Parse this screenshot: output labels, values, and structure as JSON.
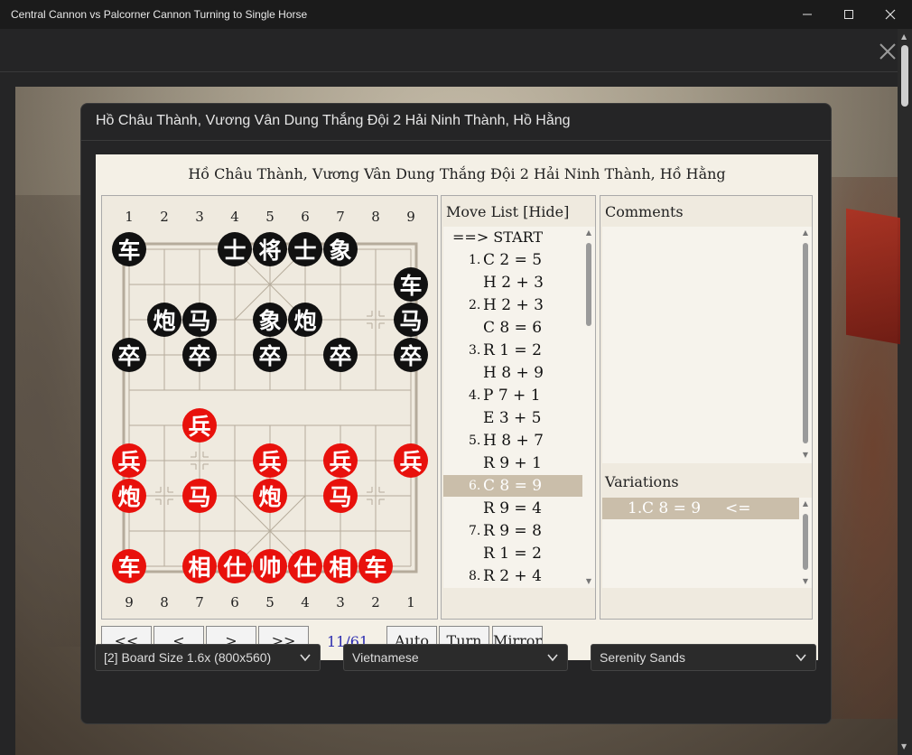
{
  "window": {
    "title": "Central Cannon vs Palcorner Cannon Turning to Single Horse"
  },
  "dialog": {
    "title": "Hồ Châu Thành, Vương Vân Dung Thắng Đội 2 Hải Ninh Thành, Hồ Hằng"
  },
  "board": {
    "heading": "Hồ Châu Thành, Vương Vân Dung Thắng Đội 2 Hải Ninh Thành, Hồ Hằng",
    "top_numbers": [
      "1",
      "2",
      "3",
      "4",
      "5",
      "6",
      "7",
      "8",
      "9"
    ],
    "bottom_numbers": [
      "9",
      "8",
      "7",
      "6",
      "5",
      "4",
      "3",
      "2",
      "1"
    ],
    "pieces": [
      {
        "side": "black",
        "glyph": "车",
        "file": 1,
        "rank": 0
      },
      {
        "side": "black",
        "glyph": "士",
        "file": 4,
        "rank": 0
      },
      {
        "side": "black",
        "glyph": "将",
        "file": 5,
        "rank": 0
      },
      {
        "side": "black",
        "glyph": "士",
        "file": 6,
        "rank": 0
      },
      {
        "side": "black",
        "glyph": "象",
        "file": 7,
        "rank": 0
      },
      {
        "side": "black",
        "glyph": "车",
        "file": 9,
        "rank": 1
      },
      {
        "side": "black",
        "glyph": "炮",
        "file": 2,
        "rank": 2
      },
      {
        "side": "black",
        "glyph": "马",
        "file": 3,
        "rank": 2
      },
      {
        "side": "black",
        "glyph": "象",
        "file": 5,
        "rank": 2
      },
      {
        "side": "black",
        "glyph": "炮",
        "file": 6,
        "rank": 2
      },
      {
        "side": "black",
        "glyph": "马",
        "file": 9,
        "rank": 2
      },
      {
        "side": "black",
        "glyph": "卒",
        "file": 1,
        "rank": 3
      },
      {
        "side": "black",
        "glyph": "卒",
        "file": 3,
        "rank": 3
      },
      {
        "side": "black",
        "glyph": "卒",
        "file": 5,
        "rank": 3
      },
      {
        "side": "black",
        "glyph": "卒",
        "file": 7,
        "rank": 3
      },
      {
        "side": "black",
        "glyph": "卒",
        "file": 9,
        "rank": 3
      },
      {
        "side": "red",
        "glyph": "兵",
        "file": 3,
        "rank": 5
      },
      {
        "side": "red",
        "glyph": "兵",
        "file": 1,
        "rank": 6
      },
      {
        "side": "red",
        "glyph": "兵",
        "file": 5,
        "rank": 6
      },
      {
        "side": "red",
        "glyph": "兵",
        "file": 7,
        "rank": 6
      },
      {
        "side": "red",
        "glyph": "兵",
        "file": 9,
        "rank": 6
      },
      {
        "side": "red",
        "glyph": "炮",
        "file": 1,
        "rank": 7
      },
      {
        "side": "red",
        "glyph": "马",
        "file": 3,
        "rank": 7
      },
      {
        "side": "red",
        "glyph": "炮",
        "file": 5,
        "rank": 7
      },
      {
        "side": "red",
        "glyph": "马",
        "file": 7,
        "rank": 7
      },
      {
        "side": "red",
        "glyph": "车",
        "file": 1,
        "rank": 9
      },
      {
        "side": "red",
        "glyph": "相",
        "file": 3,
        "rank": 9
      },
      {
        "side": "red",
        "glyph": "仕",
        "file": 4,
        "rank": 9
      },
      {
        "side": "red",
        "glyph": "帅",
        "file": 5,
        "rank": 9
      },
      {
        "side": "red",
        "glyph": "仕",
        "file": 6,
        "rank": 9
      },
      {
        "side": "red",
        "glyph": "相",
        "file": 7,
        "rank": 9
      },
      {
        "side": "red",
        "glyph": "车",
        "file": 8,
        "rank": 9
      }
    ]
  },
  "moves": {
    "header": "Move List [Hide]",
    "rows": [
      {
        "num": "",
        "move": "==> START",
        "selected": false
      },
      {
        "num": "1.",
        "move": "C 2 = 5",
        "selected": false
      },
      {
        "num": "",
        "move": "H 2 + 3",
        "selected": false
      },
      {
        "num": "2.",
        "move": "H 2 + 3",
        "selected": false
      },
      {
        "num": "",
        "move": "C 8 = 6",
        "selected": false
      },
      {
        "num": "3.",
        "move": "R 1 = 2",
        "selected": false
      },
      {
        "num": "",
        "move": "H 8 + 9",
        "selected": false
      },
      {
        "num": "4.",
        "move": "P 7 + 1",
        "selected": false
      },
      {
        "num": "",
        "move": "E 3 + 5",
        "selected": false
      },
      {
        "num": "5.",
        "move": "H 8 + 7",
        "selected": false
      },
      {
        "num": "",
        "move": "R 9 + 1",
        "selected": false
      },
      {
        "num": "6.",
        "move": "C 8 = 9",
        "selected": true
      },
      {
        "num": "",
        "move": "R 9 = 4",
        "selected": false
      },
      {
        "num": "7.",
        "move": "R 9 = 8",
        "selected": false
      },
      {
        "num": "",
        "move": "R 1 = 2",
        "selected": false
      },
      {
        "num": "8.",
        "move": "R 2 + 4",
        "selected": false
      }
    ]
  },
  "comments": {
    "header": "Comments"
  },
  "variations": {
    "header": "Variations",
    "items": [
      {
        "num": "1.",
        "move": "C 8 = 9",
        "marker": "<="
      }
    ]
  },
  "nav": {
    "first": "<<",
    "prev": "<",
    "next": ">",
    "last": ">>",
    "counter": "11/61",
    "auto": "Auto",
    "turn": "Turn",
    "mirror": "Mirror"
  },
  "settings": {
    "board_size": "[2] Board Size 1.6x (800x560)",
    "language": "Vietnamese",
    "theme": "Serenity Sands"
  },
  "colors": {
    "red_piece": "#e8110c",
    "black_piece": "#111111",
    "counter": "#2d2db0",
    "selection": "#cabeaa"
  }
}
